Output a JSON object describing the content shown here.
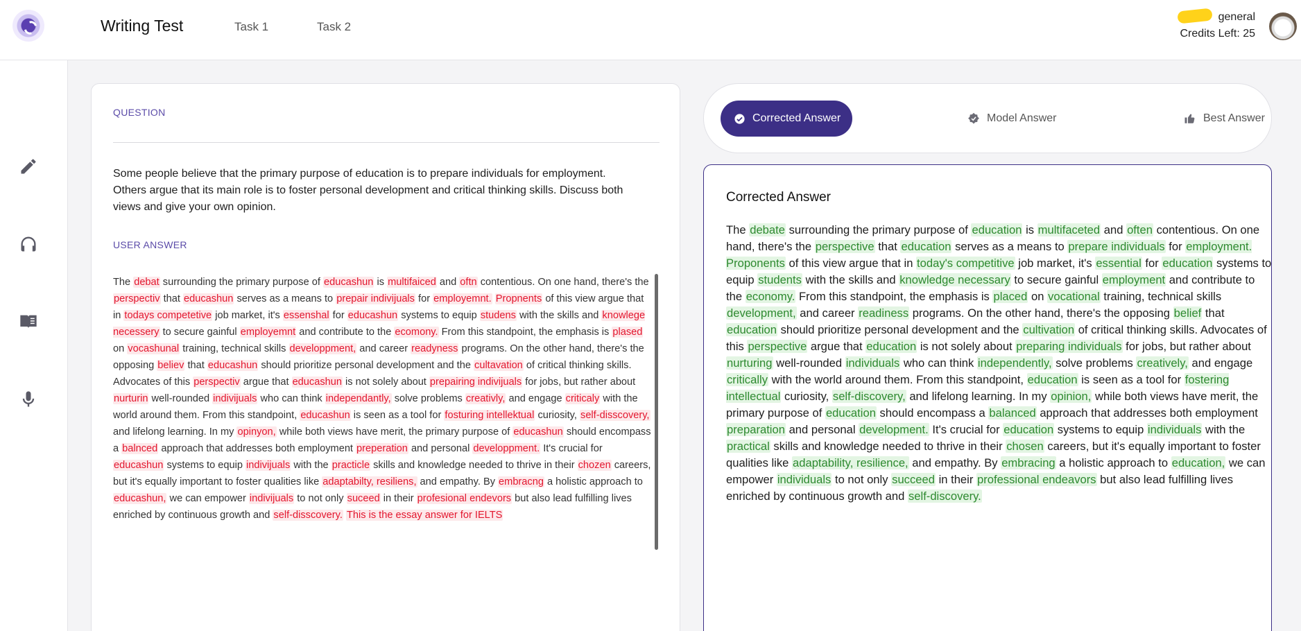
{
  "header": {
    "app_title": "Writing Test",
    "tabs": [
      "Task 1",
      "Task 2"
    ],
    "user_name": "general",
    "credits": "Credits Left: 25"
  },
  "sidebar": {
    "items": [
      {
        "icon": "pencil-icon"
      },
      {
        "icon": "headphones-icon"
      },
      {
        "icon": "book-icon"
      },
      {
        "icon": "microphone-icon"
      }
    ]
  },
  "question": {
    "label": "QUESTION",
    "text": "Some people believe that the primary purpose of education is to prepare individuals for employment. Others argue that its main role is to foster personal development and critical thinking skills. Discuss both views and give your own opinion."
  },
  "user_answer": {
    "label": "USER ANSWER",
    "segments": [
      [
        "The ",
        false
      ],
      [
        "debat",
        true
      ],
      [
        " surrounding the primary purpose of ",
        false
      ],
      [
        "educashun",
        true
      ],
      [
        " is ",
        false
      ],
      [
        "multifaiced",
        true
      ],
      [
        " and ",
        false
      ],
      [
        "oftn",
        true
      ],
      [
        " contentious. On one hand, there's the ",
        false
      ],
      [
        "perspectiv",
        true
      ],
      [
        " that ",
        false
      ],
      [
        "educashun",
        true
      ],
      [
        " serves as a means to ",
        false
      ],
      [
        "prepair indivijuals",
        true
      ],
      [
        " for ",
        false
      ],
      [
        "employemnt.",
        true
      ],
      [
        " ",
        false
      ],
      [
        "Propnents",
        true
      ],
      [
        " of this view argue that in ",
        false
      ],
      [
        "todays competetive",
        true
      ],
      [
        " job market, it's ",
        false
      ],
      [
        "essenshal",
        true
      ],
      [
        " for ",
        false
      ],
      [
        "educashun",
        true
      ],
      [
        " systems to equip ",
        false
      ],
      [
        "studens",
        true
      ],
      [
        " with the skills and ",
        false
      ],
      [
        "knowlege necessery",
        true
      ],
      [
        " to secure gainful ",
        false
      ],
      [
        "employemnt",
        true
      ],
      [
        " and contribute to the ",
        false
      ],
      [
        "ecomony.",
        true
      ],
      [
        " From this standpoint, the emphasis is ",
        false
      ],
      [
        "plased",
        true
      ],
      [
        " on ",
        false
      ],
      [
        "vocashunal",
        true
      ],
      [
        " training, technical skills ",
        false
      ],
      [
        "developpment,",
        true
      ],
      [
        " and career ",
        false
      ],
      [
        "readyness",
        true
      ],
      [
        " programs. On the other hand, there's the opposing ",
        false
      ],
      [
        "believ",
        true
      ],
      [
        " that ",
        false
      ],
      [
        "educashun",
        true
      ],
      [
        " should prioritize personal development and the ",
        false
      ],
      [
        "cultavation",
        true
      ],
      [
        " of critical thinking skills. Advocates of this ",
        false
      ],
      [
        "perspectiv",
        true
      ],
      [
        " argue that ",
        false
      ],
      [
        "educashun",
        true
      ],
      [
        " is not solely about ",
        false
      ],
      [
        "prepairing indivijuals",
        true
      ],
      [
        " for jobs, but rather about ",
        false
      ],
      [
        "nurturin",
        true
      ],
      [
        " well-rounded ",
        false
      ],
      [
        "indivijuals",
        true
      ],
      [
        " who can think ",
        false
      ],
      [
        "independantly,",
        true
      ],
      [
        " solve problems ",
        false
      ],
      [
        "creativly,",
        true
      ],
      [
        " and engage ",
        false
      ],
      [
        "criticaly",
        true
      ],
      [
        " with the world around them. From this standpoint, ",
        false
      ],
      [
        "educashun",
        true
      ],
      [
        " is seen as a tool for ",
        false
      ],
      [
        "fosturing intellektual",
        true
      ],
      [
        " curiosity, ",
        false
      ],
      [
        "self-disscovery,",
        true
      ],
      [
        " and lifelong learning. In my ",
        false
      ],
      [
        "opinyon,",
        true
      ],
      [
        " while both views have merit, the primary purpose of ",
        false
      ],
      [
        "educashun",
        true
      ],
      [
        " should encompass a ",
        false
      ],
      [
        "balnced",
        true
      ],
      [
        " approach that addresses both employment ",
        false
      ],
      [
        "preperation",
        true
      ],
      [
        " and personal ",
        false
      ],
      [
        "developpment.",
        true
      ],
      [
        " It's crucial for ",
        false
      ],
      [
        "educashun",
        true
      ],
      [
        " systems to equip ",
        false
      ],
      [
        "indivijuals",
        true
      ],
      [
        " with the ",
        false
      ],
      [
        "practicle",
        true
      ],
      [
        " skills and knowledge needed to thrive in their ",
        false
      ],
      [
        "chozen",
        true
      ],
      [
        " careers, but it's equally important to foster qualities like ",
        false
      ],
      [
        "adaptabilty, resiliens,",
        true
      ],
      [
        " and empathy. By ",
        false
      ],
      [
        "embracng",
        true
      ],
      [
        " a holistic approach to ",
        false
      ],
      [
        "educashun,",
        true
      ],
      [
        " we can empower ",
        false
      ],
      [
        "indivijuals",
        true
      ],
      [
        " to not only ",
        false
      ],
      [
        "suceed",
        true
      ],
      [
        " in their ",
        false
      ],
      [
        "profesional endevors",
        true
      ],
      [
        " but also lead fulfilling lives enriched by continuous growth and ",
        false
      ],
      [
        "self-disscovery.",
        true
      ],
      [
        " ",
        false
      ],
      [
        "This is the essay answer for IELTS",
        true
      ]
    ]
  },
  "result_tabs": [
    {
      "label": "Corrected Answer",
      "icon": "check-circle-icon",
      "active": true
    },
    {
      "label": "Model Answer",
      "icon": "verified-badge-icon",
      "active": false
    },
    {
      "label": "Best Answer",
      "icon": "thumbs-up-icon",
      "active": false
    }
  ],
  "corrected": {
    "title": "Corrected Answer",
    "segments": [
      [
        "The ",
        false
      ],
      [
        "debate",
        true
      ],
      [
        " surrounding the primary purpose of ",
        false
      ],
      [
        "education",
        true
      ],
      [
        " is ",
        false
      ],
      [
        "multifaceted",
        true
      ],
      [
        " and ",
        false
      ],
      [
        "often",
        true
      ],
      [
        " contentious. On one hand, there's the ",
        false
      ],
      [
        "perspective",
        true
      ],
      [
        " that ",
        false
      ],
      [
        "education",
        true
      ],
      [
        " serves as a means to ",
        false
      ],
      [
        "prepare individuals",
        true
      ],
      [
        " for ",
        false
      ],
      [
        "employment. Proponents",
        true
      ],
      [
        " of this view argue that in ",
        false
      ],
      [
        "today's competitive",
        true
      ],
      [
        " job market, it's ",
        false
      ],
      [
        "essential",
        true
      ],
      [
        " for ",
        false
      ],
      [
        "education",
        true
      ],
      [
        " systems to equip ",
        false
      ],
      [
        "students",
        true
      ],
      [
        " with the skills and ",
        false
      ],
      [
        "knowledge necessary",
        true
      ],
      [
        " to secure gainful ",
        false
      ],
      [
        "employment",
        true
      ],
      [
        " and contribute to the ",
        false
      ],
      [
        "economy.",
        true
      ],
      [
        " From this standpoint, the emphasis is ",
        false
      ],
      [
        "placed",
        true
      ],
      [
        " on ",
        false
      ],
      [
        "vocational",
        true
      ],
      [
        " training, technical skills ",
        false
      ],
      [
        "development,",
        true
      ],
      [
        " and career ",
        false
      ],
      [
        "readiness",
        true
      ],
      [
        " programs. On the other hand, there's the opposing ",
        false
      ],
      [
        "belief",
        true
      ],
      [
        " that ",
        false
      ],
      [
        "education",
        true
      ],
      [
        " should prioritize personal development and the ",
        false
      ],
      [
        "cultivation",
        true
      ],
      [
        " of critical thinking skills. Advocates of this ",
        false
      ],
      [
        "perspective",
        true
      ],
      [
        " argue that ",
        false
      ],
      [
        "education",
        true
      ],
      [
        " is not solely about ",
        false
      ],
      [
        "preparing individuals",
        true
      ],
      [
        " for jobs, but rather about ",
        false
      ],
      [
        "nurturing",
        true
      ],
      [
        " well-rounded ",
        false
      ],
      [
        "individuals",
        true
      ],
      [
        " who can think ",
        false
      ],
      [
        "independently,",
        true
      ],
      [
        " solve problems ",
        false
      ],
      [
        "creatively,",
        true
      ],
      [
        " and engage ",
        false
      ],
      [
        "critically",
        true
      ],
      [
        " with the world around them. From this standpoint, ",
        false
      ],
      [
        "education",
        true
      ],
      [
        " is seen as a tool for ",
        false
      ],
      [
        "fostering intellectual",
        true
      ],
      [
        " curiosity, ",
        false
      ],
      [
        "self-discovery,",
        true
      ],
      [
        " and lifelong learning. In my ",
        false
      ],
      [
        "opinion,",
        true
      ],
      [
        " while both views have merit, the primary purpose of ",
        false
      ],
      [
        "education",
        true
      ],
      [
        " should encompass a ",
        false
      ],
      [
        "balanced",
        true
      ],
      [
        " approach that addresses both employment ",
        false
      ],
      [
        "preparation",
        true
      ],
      [
        " and personal ",
        false
      ],
      [
        "development.",
        true
      ],
      [
        " It's crucial for ",
        false
      ],
      [
        "education",
        true
      ],
      [
        " systems to equip ",
        false
      ],
      [
        "individuals",
        true
      ],
      [
        " with the ",
        false
      ],
      [
        "practical",
        true
      ],
      [
        " skills and knowledge needed to thrive in their ",
        false
      ],
      [
        "chosen",
        true
      ],
      [
        " careers, but it's equally important to foster qualities like ",
        false
      ],
      [
        "adaptability, resilience,",
        true
      ],
      [
        " and empathy. By ",
        false
      ],
      [
        "embracing",
        true
      ],
      [
        " a holistic approach to ",
        false
      ],
      [
        "education,",
        true
      ],
      [
        " we can empower ",
        false
      ],
      [
        "individuals",
        true
      ],
      [
        " to not only ",
        false
      ],
      [
        "succeed",
        true
      ],
      [
        " in their ",
        false
      ],
      [
        "professional endeavors",
        true
      ],
      [
        " but also lead fulfilling lives enriched by continuous growth and ",
        false
      ],
      [
        "self-discovery.",
        true
      ]
    ]
  },
  "colors": {
    "accent": "#3c2f86",
    "error_text": "#e3162e",
    "error_bg": "#fde8ea",
    "fix_text": "#2e8a30",
    "fix_bg": "#e3f5e3"
  }
}
